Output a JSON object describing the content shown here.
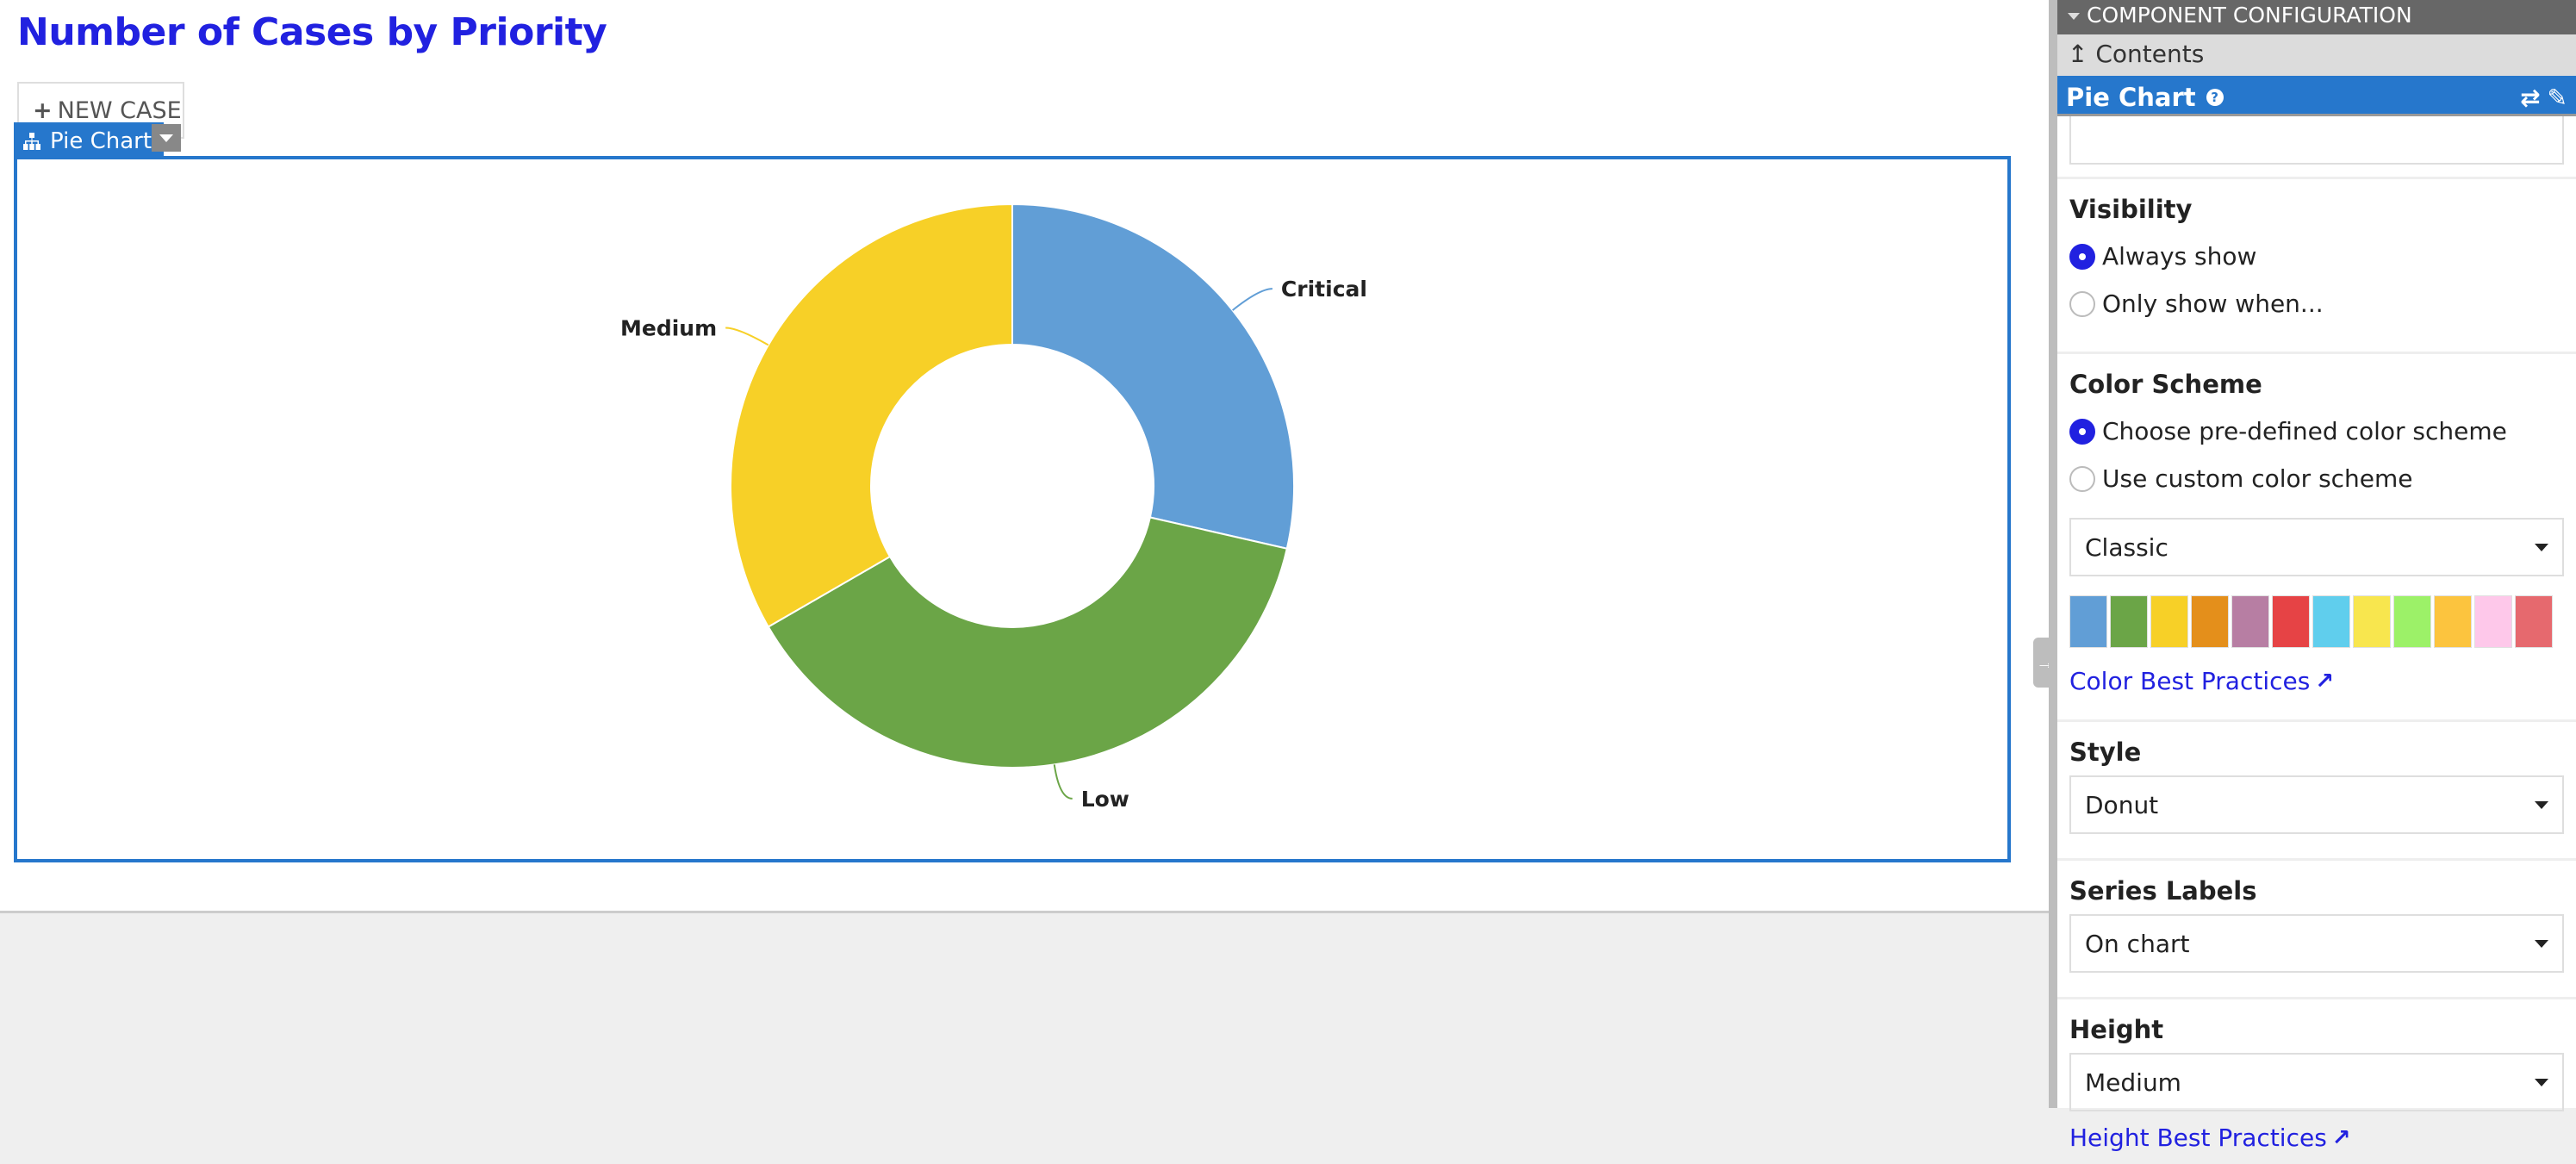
{
  "page": {
    "title": "Number of Cases by Priority",
    "new_case_label": "NEW CASE",
    "new_case_icon": "plus-icon",
    "component_tab_label": "Pie Chart",
    "component_tab_icon": "hierarchy-icon"
  },
  "panel": {
    "header": "COMPONENT CONFIGURATION",
    "contents_label": "Contents",
    "component_name": "Pie Chart",
    "name_input_value": "",
    "visibility": {
      "title": "Visibility",
      "options": [
        {
          "label": "Always show",
          "selected": true
        },
        {
          "label": "Only show when...",
          "selected": false
        }
      ]
    },
    "color_scheme": {
      "title": "Color Scheme",
      "options": [
        {
          "label": "Choose pre-defined color scheme",
          "selected": true
        },
        {
          "label": "Use custom color scheme",
          "selected": false
        }
      ],
      "selected": "Classic",
      "swatches": [
        "#619ED6",
        "#6BA547",
        "#F7D027",
        "#E48F1B",
        "#B77EA3",
        "#E64345",
        "#60CEED",
        "#F8E64E",
        "#9CF168",
        "#FCC43E",
        "#FEC8EA",
        "#E6696E"
      ],
      "link": "Color Best Practices"
    },
    "style": {
      "title": "Style",
      "selected": "Donut"
    },
    "series_labels": {
      "title": "Series Labels",
      "selected": "On chart"
    },
    "height": {
      "title": "Height",
      "selected": "Medium",
      "link": "Height Best Practices"
    }
  },
  "chart_data": {
    "type": "pie",
    "style": "donut",
    "title": "Number of Cases by Priority",
    "categories": [
      "Critical",
      "Low",
      "Medium"
    ],
    "values": [
      6,
      8,
      7
    ],
    "colors": [
      "#619ED6",
      "#6BA547",
      "#F7D027"
    ],
    "series_labels": "on chart",
    "legend": "none"
  }
}
